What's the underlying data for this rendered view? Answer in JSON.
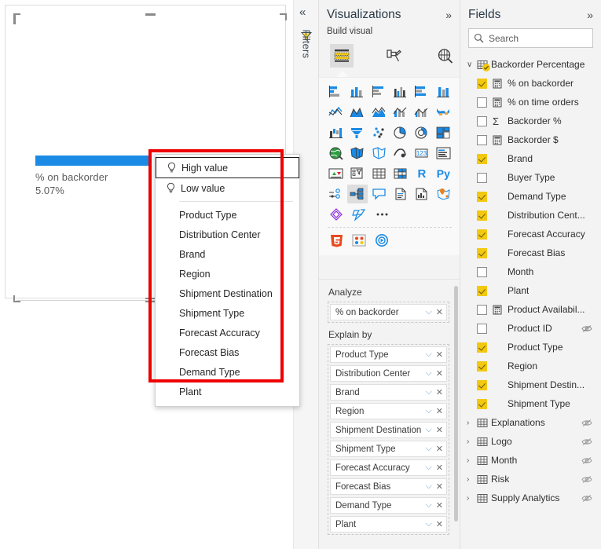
{
  "canvas": {
    "visual": {
      "label": "% on backorder",
      "value": "5.07%",
      "bar_color": "#1a8ae5"
    }
  },
  "context_menu": {
    "items": [
      {
        "label": "High value",
        "icon": "lightbulb-icon",
        "focused": true
      },
      {
        "label": "Low value",
        "icon": "lightbulb-icon",
        "focused": false
      }
    ],
    "fields": [
      "Product Type",
      "Distribution Center",
      "Brand",
      "Region",
      "Shipment Destination",
      "Shipment Type",
      "Forecast Accuracy",
      "Forecast Bias",
      "Demand Type",
      "Plant"
    ]
  },
  "annotation": {
    "color": "#ee0000"
  },
  "filters_rail": {
    "collapse_label": "«",
    "filter_icon": "filter-funnel-icon",
    "label": "Filters"
  },
  "visualizations": {
    "title": "Visualizations",
    "expand_label": "»",
    "build_visual_label": "Build visual",
    "tabs": [
      {
        "name": "build-visual-tab",
        "icon": "fields-table-icon",
        "active": true
      },
      {
        "name": "format-visual-tab",
        "icon": "paint-roller-icon",
        "active": false
      },
      {
        "name": "analytics-tab",
        "icon": "magnifier-chart-icon",
        "active": false
      }
    ],
    "gallery": {
      "rows": [
        [
          "stacked-bar-chart-icon",
          "stacked-column-chart-icon",
          "clustered-bar-chart-icon",
          "clustered-column-chart-icon",
          "hundred-percent-stacked-bar-icon",
          "hundred-percent-stacked-column-icon"
        ],
        [
          "line-chart-icon",
          "area-chart-icon",
          "stacked-area-chart-icon",
          "line-stacked-column-icon",
          "line-clustered-column-icon",
          "ribbon-chart-icon"
        ],
        [
          "waterfall-chart-icon",
          "funnel-chart-icon",
          "scatter-chart-icon",
          "pie-chart-icon",
          "donut-chart-icon",
          "treemap-icon"
        ],
        [
          "map-icon",
          "filled-map-icon",
          "shape-map-icon",
          "azure-map-icon",
          "card-icon",
          "multi-row-card-icon"
        ],
        [
          "kpi-icon",
          "slicer-icon",
          "table-icon",
          "matrix-icon",
          "r-script-visual-icon",
          "python-visual-icon"
        ],
        [
          "key-influencers-icon",
          "decomposition-tree-icon",
          "qna-icon",
          "smart-narrative-icon",
          "paginated-report-icon",
          "arcgis-map-icon"
        ],
        [
          "power-apps-icon",
          "power-automate-icon",
          "more-options-icon"
        ]
      ],
      "custom_row": [
        "html-visual-icon",
        "custom-visual-icon",
        "play-axis-icon"
      ],
      "selected": "decomposition-tree-icon"
    },
    "analyze": {
      "title": "Analyze",
      "chips": [
        "% on backorder"
      ]
    },
    "explain_by": {
      "title": "Explain by",
      "chips": [
        "Product Type",
        "Distribution Center",
        "Brand",
        "Region",
        "Shipment Destination",
        "Shipment Type",
        "Forecast Accuracy",
        "Forecast Bias",
        "Demand Type",
        "Plant"
      ]
    }
  },
  "fields": {
    "title": "Fields",
    "expand_label": "»",
    "search": {
      "placeholder": "Search",
      "value": ""
    },
    "tables": [
      {
        "name": "Backorder Percentage",
        "expanded": true,
        "checked": true,
        "hidden": false,
        "fields": [
          {
            "name": "% on backorder",
            "checked": true,
            "glyph": "calculated-measure-icon",
            "hidden": false
          },
          {
            "name": "% on time orders",
            "checked": false,
            "glyph": "calculated-measure-icon",
            "hidden": false
          },
          {
            "name": "Backorder %",
            "checked": false,
            "glyph": "sigma-icon",
            "hidden": false
          },
          {
            "name": "Backorder $",
            "checked": false,
            "glyph": "calculated-measure-icon",
            "hidden": false
          },
          {
            "name": "Brand",
            "checked": true,
            "glyph": "",
            "hidden": false
          },
          {
            "name": "Buyer Type",
            "checked": false,
            "glyph": "",
            "hidden": false
          },
          {
            "name": "Demand Type",
            "checked": true,
            "glyph": "",
            "hidden": false
          },
          {
            "name": "Distribution Cent...",
            "checked": true,
            "glyph": "",
            "hidden": false
          },
          {
            "name": "Forecast Accuracy",
            "checked": true,
            "glyph": "",
            "hidden": false
          },
          {
            "name": "Forecast Bias",
            "checked": true,
            "glyph": "",
            "hidden": false
          },
          {
            "name": "Month",
            "checked": false,
            "glyph": "",
            "hidden": false
          },
          {
            "name": "Plant",
            "checked": true,
            "glyph": "",
            "hidden": false
          },
          {
            "name": "Product Availabil...",
            "checked": false,
            "glyph": "calculated-measure-icon",
            "hidden": false
          },
          {
            "name": "Product ID",
            "checked": false,
            "glyph": "",
            "hidden": true
          },
          {
            "name": "Product Type",
            "checked": true,
            "glyph": "",
            "hidden": false
          },
          {
            "name": "Region",
            "checked": true,
            "glyph": "",
            "hidden": false
          },
          {
            "name": "Shipment Destin...",
            "checked": true,
            "glyph": "",
            "hidden": false
          },
          {
            "name": "Shipment Type",
            "checked": true,
            "glyph": "",
            "hidden": false
          }
        ]
      },
      {
        "name": "Explanations",
        "expanded": false,
        "checked": false,
        "hidden": true,
        "fields": []
      },
      {
        "name": "Logo",
        "expanded": false,
        "checked": false,
        "hidden": true,
        "fields": []
      },
      {
        "name": "Month",
        "expanded": false,
        "checked": false,
        "hidden": true,
        "fields": []
      },
      {
        "name": "Risk",
        "expanded": false,
        "checked": false,
        "hidden": true,
        "fields": []
      },
      {
        "name": "Supply Analytics",
        "expanded": false,
        "checked": false,
        "hidden": true,
        "fields": []
      }
    ]
  }
}
